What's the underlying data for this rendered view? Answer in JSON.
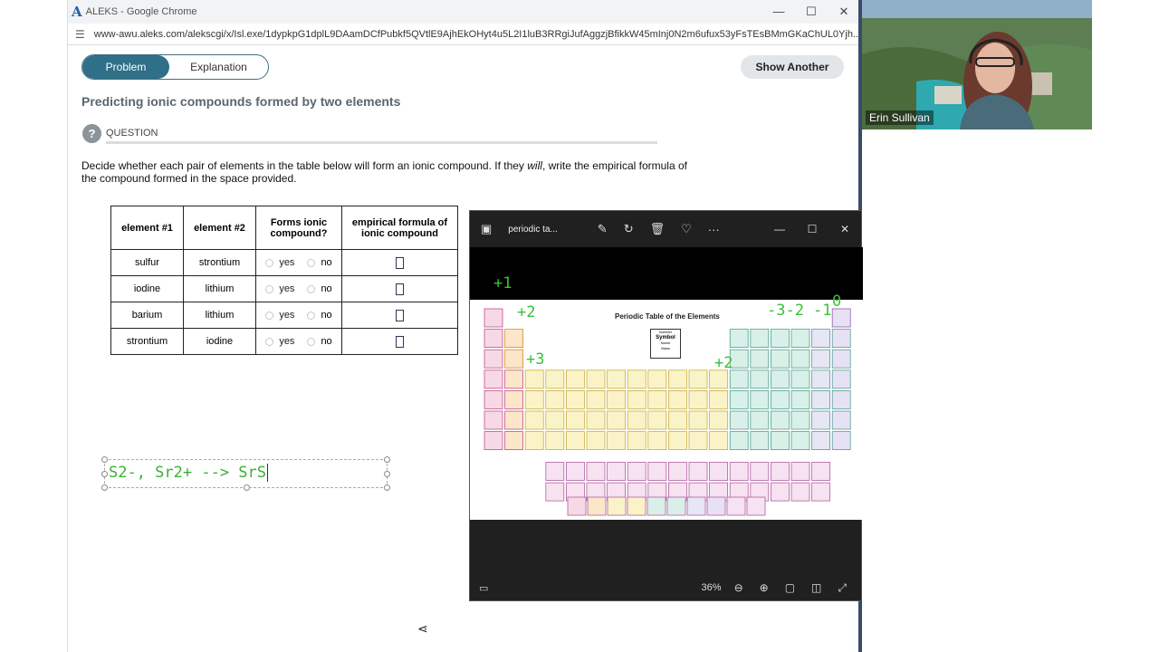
{
  "browser": {
    "logo": "A",
    "title": "ALEKS - Google Chrome",
    "url": "www-awu.aleks.com/alekscgi/x/Isl.exe/1dypkpG1dplL9DAamDCfPubkf5QVtlE9AjhEkOHyt4u5L2I1luB3RRgiJufAggzjBfikkW45mInj0N2m6ufux53yFsTEsBMmGKaChUL0Yjh..."
  },
  "tabs": {
    "problem": "Problem",
    "explanation": "Explanation"
  },
  "show_another": "Show Another",
  "heading": "Predicting ionic compounds formed by two elements",
  "question_label": "QUESTION",
  "question_icon": "?",
  "instructions": {
    "before": "Decide whether each pair of elements in the table below will form an ionic compound. If they ",
    "em": "will",
    "after": ", write the empirical formula of the compound formed in the space provided."
  },
  "table": {
    "headers": [
      "element #1",
      "element #2",
      "Forms ionic compound?",
      "empirical formula of ionic compound"
    ],
    "yes_label": "yes",
    "no_label": "no",
    "rows": [
      {
        "e1": "sulfur",
        "e2": "strontium"
      },
      {
        "e1": "iodine",
        "e2": "lithium"
      },
      {
        "e1": "barium",
        "e2": "lithium"
      },
      {
        "e1": "strontium",
        "e2": "iodine"
      }
    ]
  },
  "note_text": "S2-, Sr2+ --> SrS",
  "viewer": {
    "filename": "periodic ta...",
    "zoom": "36%",
    "table_title": "Periodic Table of the Elements",
    "legend_key": {
      "number": "Number",
      "symbol": "Symbol",
      "name": "Name",
      "mass": "Mass"
    },
    "annotations": {
      "g1": "+1",
      "g2": "+2",
      "g3": "+3",
      "g13": "+2",
      "g15_16": "-3-2",
      "g17": "-1",
      "g18": "0"
    }
  },
  "webcam": {
    "name": "Erin Sullivan"
  }
}
